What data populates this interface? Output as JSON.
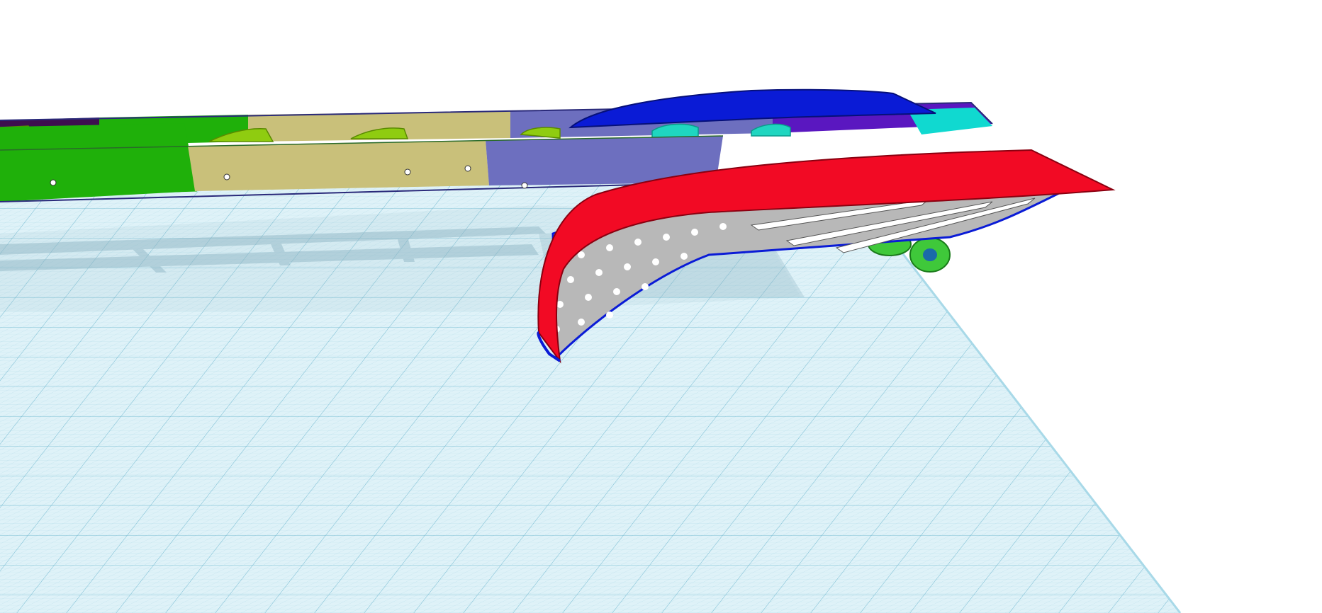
{
  "app": {
    "view": "3d-design-workplane",
    "background": "#ffffff"
  },
  "workplane": {
    "grid_color": "#7fc4d8",
    "plane_fill": "#d7eef6",
    "shadow_color": "#9fbfcc"
  },
  "model": {
    "parts": [
      {
        "name": "back-rail",
        "colors": [
          "#3d0f4f",
          "#1fb00a",
          "#c9c07a",
          "#6d6fbf",
          "#5a17c0",
          "#10d9d0"
        ]
      },
      {
        "name": "front-rail",
        "colors": [
          "#1fb00a",
          "#c9c07a",
          "#6d6fbf"
        ]
      },
      {
        "name": "clamp-brackets",
        "color": "#8fcc10"
      },
      {
        "name": "teal-brackets",
        "color": "#1fd6c0"
      },
      {
        "name": "upper-blue-wing",
        "color": "#0a1bd6"
      },
      {
        "name": "red-wing",
        "color": "#f20a24"
      },
      {
        "name": "wing-underside",
        "color": "#b8b8b8"
      },
      {
        "name": "wing-edge",
        "color": "#0a1bd6"
      },
      {
        "name": "green-wheels",
        "color": "#3fc83a"
      }
    ]
  }
}
